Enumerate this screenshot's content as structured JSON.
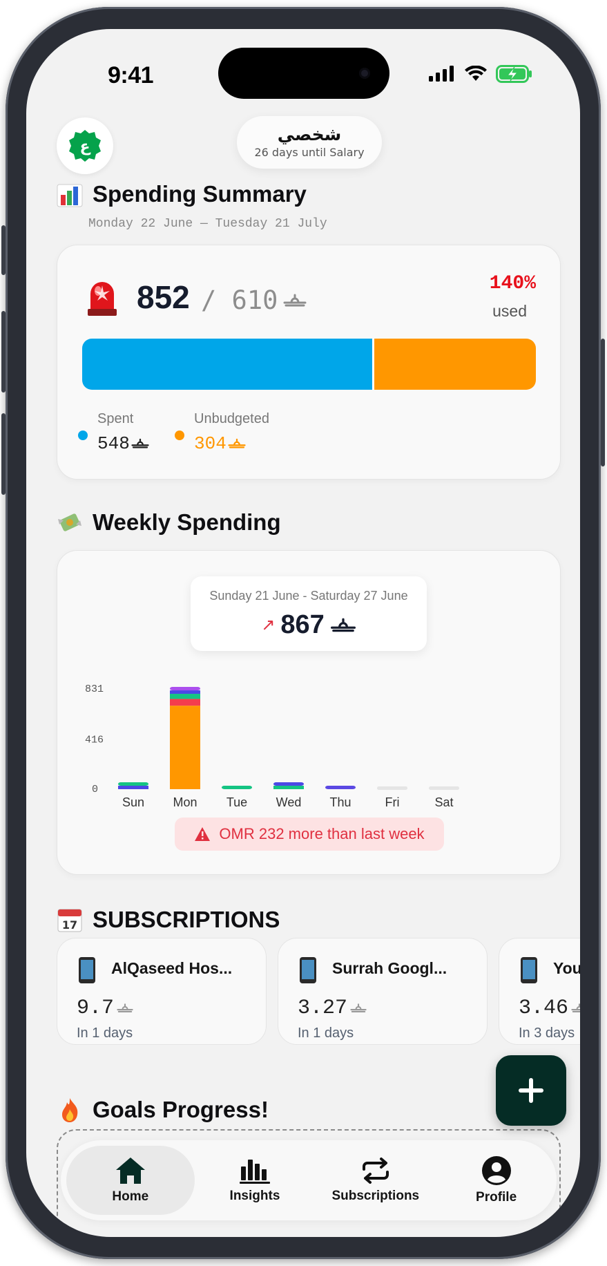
{
  "status_bar": {
    "time": "9:41"
  },
  "header": {
    "avatar_letter": "ع",
    "account_name": "شخصي",
    "account_sub": "26 days until Salary"
  },
  "summary": {
    "title": "Spending Summary",
    "date_range": "Monday 22 June — Tuesday 21 July",
    "spent_total": "852",
    "budget": "/ 610",
    "percent": "140%",
    "percent_label": "used",
    "spent_fraction": 0.64,
    "legend": [
      {
        "label": "Spent",
        "value": "548",
        "color": "#00a6e9"
      },
      {
        "label": "Unbudgeted",
        "value": "304",
        "color": "#ff9700"
      }
    ]
  },
  "weekly": {
    "title": "Weekly Spending",
    "popup_range": "Sunday 21 June - Saturday 27 June",
    "popup_total": "867",
    "popup_arrow": "↗",
    "warning": "OMR 232 more than last week"
  },
  "chart_data": {
    "type": "bar",
    "categories": [
      "Sun",
      "Mon",
      "Tue",
      "Wed",
      "Thu",
      "Fri",
      "Sat"
    ],
    "yticks": [
      "831",
      "416",
      "0"
    ],
    "ylim": [
      0,
      831
    ],
    "stacks": [
      [
        {
          "value": 9,
          "color": "#4c48e6"
        },
        {
          "value": 12,
          "color": "#15c483"
        }
      ],
      [
        {
          "value": 683,
          "color": "#ff9700"
        },
        {
          "value": 55,
          "color": "#f43d4d"
        },
        {
          "value": 42,
          "color": "#15c483"
        },
        {
          "value": 24,
          "color": "#4c48e6"
        },
        {
          "value": 17,
          "color": "#ab4fee"
        }
      ],
      [
        {
          "value": 21,
          "color": "#15c483"
        }
      ],
      [
        {
          "value": 12,
          "color": "#15c483"
        },
        {
          "value": 9,
          "color": "#4c48e6"
        }
      ],
      [
        {
          "value": 21,
          "color": "#5b49e3"
        }
      ],
      [
        {
          "value": 0,
          "color": "#e5e5e5"
        }
      ],
      [
        {
          "value": 0,
          "color": "#e5e5e5"
        }
      ]
    ]
  },
  "subscriptions": {
    "title": "SUBSCRIPTIONS",
    "items": [
      {
        "name": "AlQaseed Hos...",
        "amount": "9.7",
        "due": "In 1 days"
      },
      {
        "name": "Surrah Googl...",
        "amount": "3.27",
        "due": "In 1 days"
      },
      {
        "name": "Yout",
        "amount": "3.46",
        "due": "In 3 days"
      }
    ]
  },
  "goals": {
    "title": "Goals Progress!"
  },
  "tabbar": {
    "tabs": [
      {
        "label": "Home",
        "icon": "home-icon",
        "active": true
      },
      {
        "label": "Insights",
        "icon": "insights-icon",
        "active": false
      },
      {
        "label": "Subscriptions",
        "icon": "repeat-icon",
        "active": false
      },
      {
        "label": "Profile",
        "icon": "profile-icon",
        "active": false
      }
    ]
  },
  "colors": {
    "brand_green": "#05a24b",
    "dark_fab": "#052c25",
    "spent": "#00a6e9",
    "unbudgeted": "#ff9700",
    "alert": "#e8111c"
  }
}
